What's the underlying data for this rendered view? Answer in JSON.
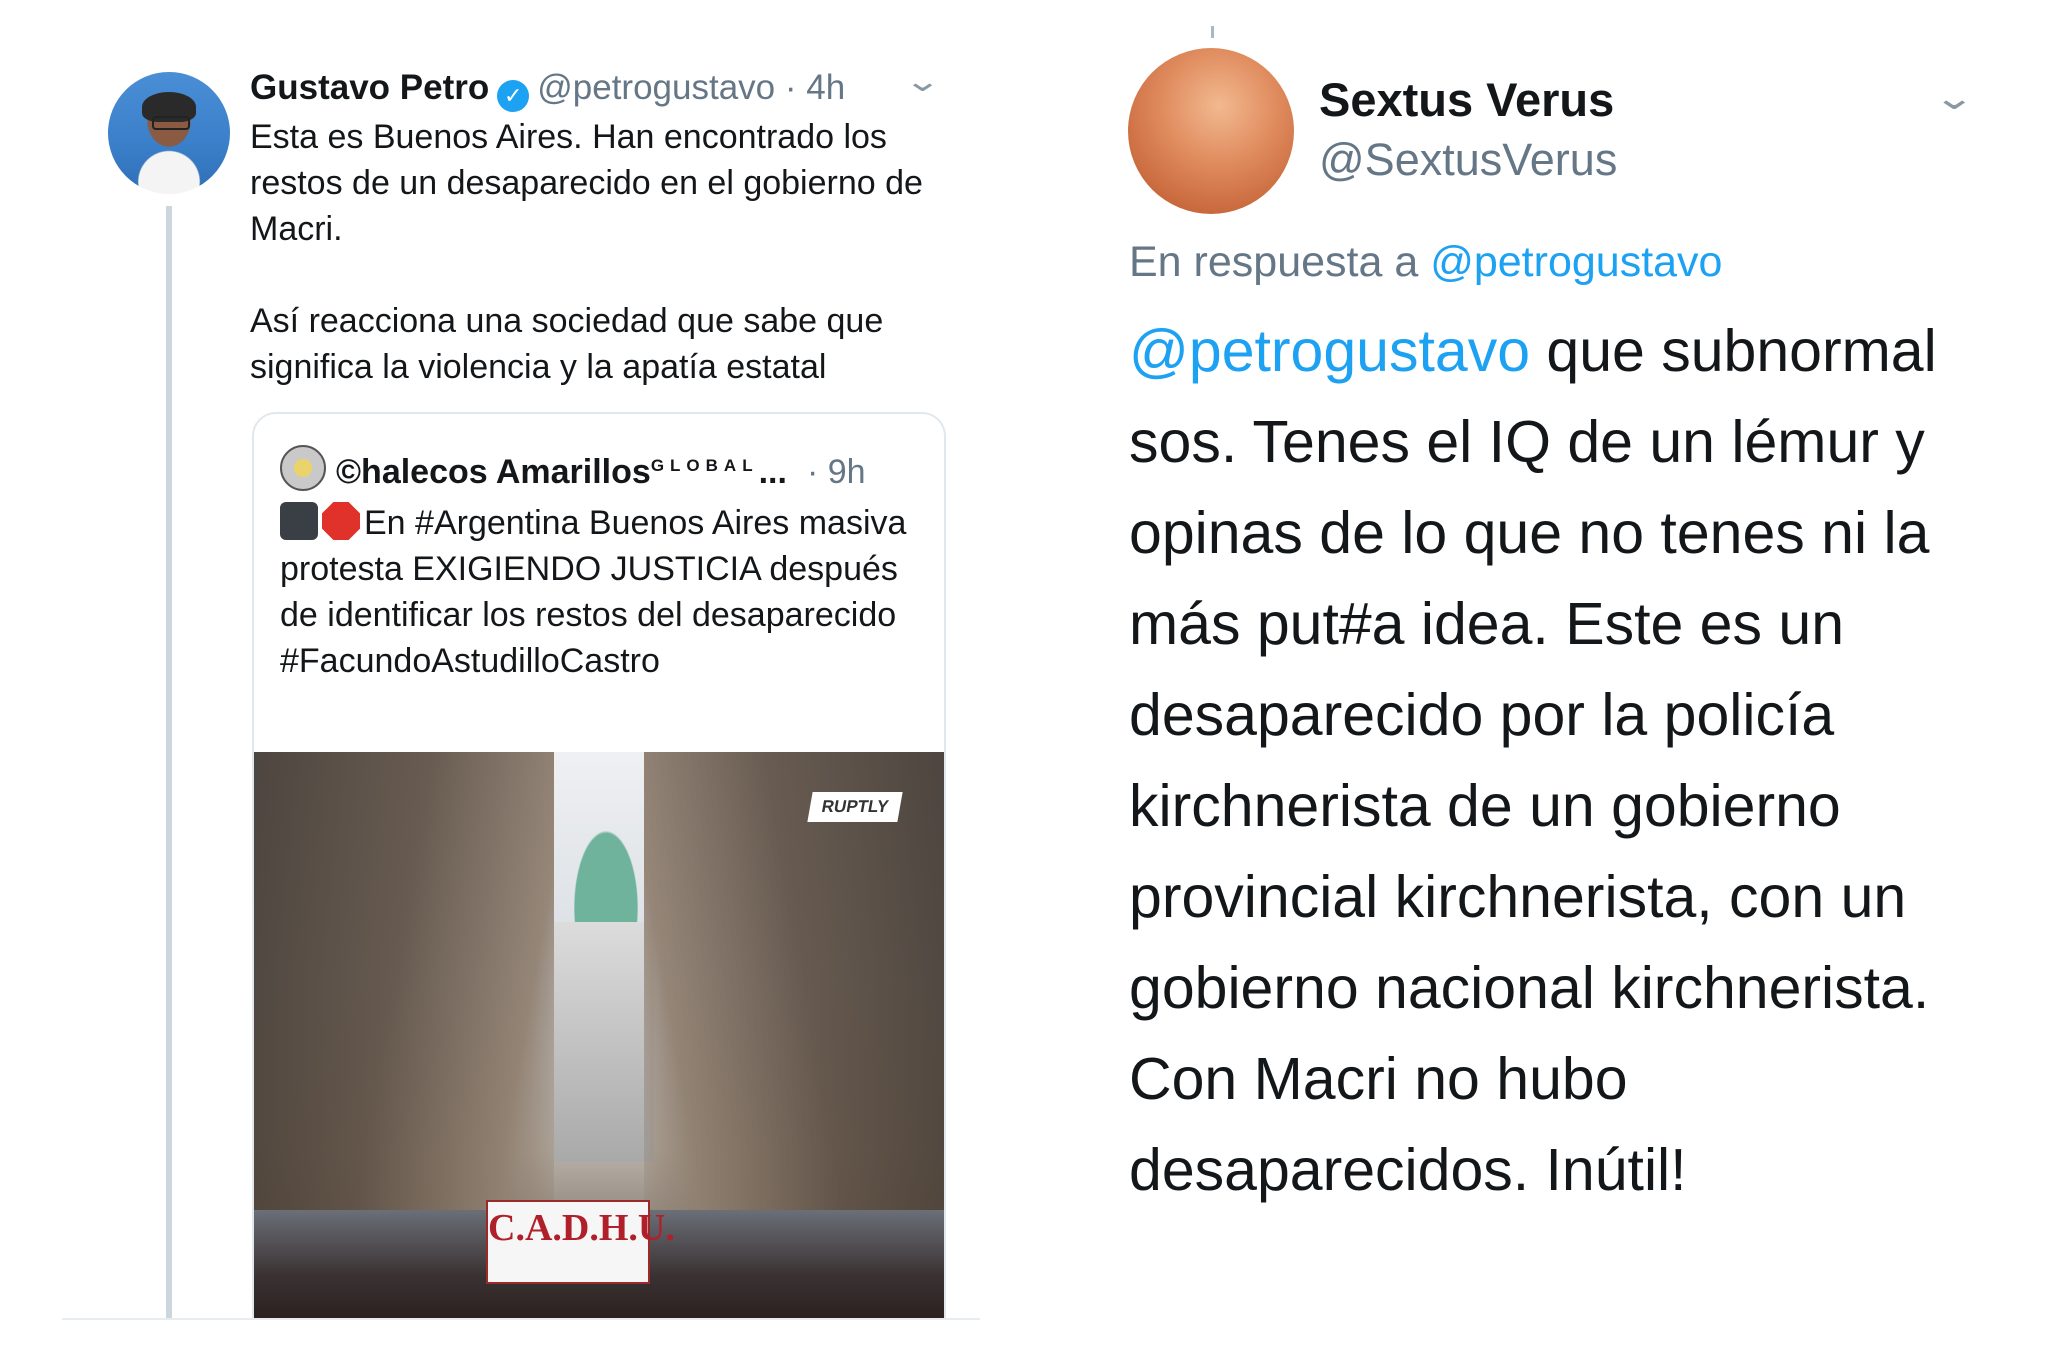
{
  "left_tweet": {
    "author_name": "Gustavo Petro",
    "verified_icon": "verified-check-icon",
    "handle": "@petrogustavo",
    "separator": " · ",
    "time": "4h",
    "text": "Esta es Buenos Aires. Han encontrado los restos de un desaparecido en el gobierno de Macri.\n\nAsí reacciona una sociedad que sabe que significa la violencia y la apatía estatal",
    "quoted": {
      "author_name": "©halecos Amarillos",
      "author_suffix": "GLOBAL",
      "ellipsis": "...",
      "time": "· 9h",
      "text": "En #Argentina Buenos Aires masiva protesta EXIGIENDO JUSTICIA después de identificar los restos del desaparecido #FacundoAstudilloCastro",
      "emojis": [
        "video-camera-icon",
        "stop-sign-icon"
      ],
      "image": {
        "watermark": "RUPTLY",
        "banner_text": "C.A.D.H.U."
      }
    }
  },
  "right_tweet": {
    "author_name": "Sextus Verus",
    "handle": "@SextusVerus",
    "reply_prefix": "En respuesta a ",
    "reply_to": "@petrogustavo",
    "mention": "@petrogustavo",
    "text": " que subnormal sos. Tenes el IQ de un lémur y opinas de lo que no tenes ni la más put#a idea. Este es un desaparecido por la policía kirchnerista de un gobierno provincial kirchnerista, con un gobierno nacional kirchnerista. Con Macri no hubo desaparecidos. Inútil!"
  },
  "colors": {
    "link": "#1da1f2",
    "secondary_text": "#657786",
    "primary_text": "#14171a",
    "border": "#e1e8ed"
  }
}
